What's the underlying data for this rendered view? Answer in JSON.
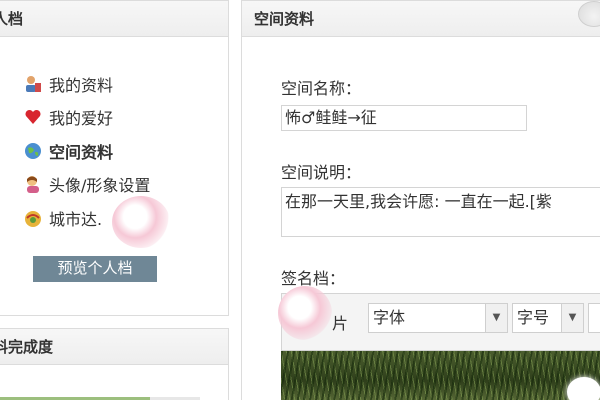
{
  "left_panel": {
    "title": "人档",
    "menu": [
      {
        "label": "我的资料",
        "icon": "user-profile-icon",
        "active": false
      },
      {
        "label": "我的爱好",
        "icon": "heart-icon",
        "active": false
      },
      {
        "label": "空间资料",
        "icon": "globe-icon",
        "active": true
      },
      {
        "label": "头像/形象设置",
        "icon": "avatar-icon",
        "active": false
      },
      {
        "label": "城市达.",
        "icon": "city-icon",
        "active": false
      }
    ],
    "preview_button": "预览个人档"
  },
  "completion_panel": {
    "title": "料完成度",
    "progress_fraction": 0.75
  },
  "right_panel": {
    "title": "空间资料",
    "name_label": "空间名称：",
    "name_value": "怖♂鲑鲑→征",
    "desc_label": "空间说明：",
    "desc_value": "在那一天里,我会许愿: 一直在一起.[紫",
    "sign_label": "签名档：",
    "toolbar": {
      "pic_label": "片",
      "font_select": "字体",
      "size_select": "字号",
      "extra_select": ""
    }
  },
  "colors": {
    "header_bg": "#eeeeee",
    "button_bg": "#6f8796",
    "border": "#dcdcdc"
  }
}
